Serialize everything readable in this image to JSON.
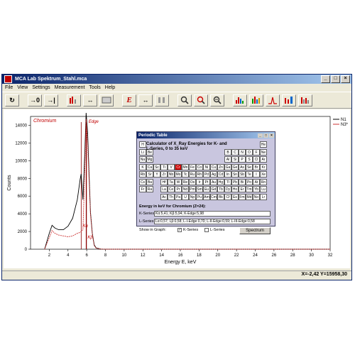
{
  "window": {
    "title": "MCA Lab    Spektrum_Stahl.mca",
    "min": "_",
    "max": "□",
    "close": "×"
  },
  "menu": [
    "File",
    "View",
    "Settings",
    "Measurement",
    "Tools",
    "Help"
  ],
  "toolbar": {
    "reset": "↻",
    "zero": "→0",
    "stop": "→|",
    "energy": "E"
  },
  "chart_data": {
    "type": "line",
    "series": [
      {
        "name": "N1",
        "color": "#000000",
        "x": [
          1.5,
          2.0,
          2.3,
          2.6,
          3.0,
          3.5,
          4.0,
          4.5,
          5.0,
          5.3,
          5.41,
          5.6,
          5.8,
          5.94,
          6.1,
          6.4,
          6.6,
          6.8,
          7.0,
          7.5,
          8.0,
          9.0,
          12,
          16,
          20,
          26,
          32
        ],
        "y": [
          0,
          1800,
          2700,
          2400,
          2200,
          2200,
          2600,
          3500,
          5600,
          7900,
          8500,
          5600,
          11000,
          15400,
          13200,
          4200,
          1800,
          500,
          150,
          20,
          0,
          0,
          0,
          0,
          0,
          0,
          0
        ]
      },
      {
        "name": "N3*",
        "color": "#cc3333",
        "x": [
          1.5,
          2.0,
          2.3,
          2.6,
          3.0,
          3.5,
          4.0,
          4.5,
          5.0,
          5.3,
          5.41,
          5.6,
          5.8,
          5.94,
          6.1,
          6.4,
          6.6,
          6.8,
          7.0,
          7.5,
          8.0,
          9.0,
          12,
          16,
          20,
          26,
          32
        ],
        "y": [
          0,
          1300,
          2100,
          1800,
          1600,
          1500,
          1400,
          1500,
          1800,
          1900,
          2000,
          2200,
          9000,
          14700,
          12000,
          4000,
          1700,
          400,
          120,
          20,
          0,
          0,
          0,
          0,
          0,
          0,
          0
        ]
      }
    ],
    "xlim": [
      0,
      32
    ],
    "ylim": [
      0,
      15000
    ],
    "xticks": [
      2,
      4,
      6,
      8,
      10,
      12,
      14,
      16,
      18,
      20,
      22,
      24,
      26,
      28,
      30,
      32
    ],
    "yticks": [
      0,
      2000,
      4000,
      6000,
      8000,
      10000,
      12000,
      14000
    ],
    "xlabel": "Energy E, keV",
    "ylabel": "Counts",
    "annotation": "Chromium",
    "markers": [
      {
        "x": 5.41,
        "label": "Kα"
      },
      {
        "x": 5.94,
        "label": "Kβ"
      },
      {
        "x": 5.98,
        "label": "Edge"
      }
    ],
    "legend_position": "top-right"
  },
  "status": "X=-2,42 Y=15958,30",
  "periodic_table": {
    "title": "Periodic Table",
    "calculator_text": "Calculator of X_Ray Energies for K- and L-Series, 0 to 35 keV",
    "selected": "Cr",
    "row1": [
      "H",
      "He"
    ],
    "row2": [
      "Li",
      "Be",
      "B",
      "C",
      "N",
      "O",
      "F",
      "Ne"
    ],
    "row3": [
      "Na",
      "Mg",
      "Al",
      "Si",
      "P",
      "S",
      "Cl",
      "Ar"
    ],
    "row4": [
      "K",
      "Ca",
      "Sc",
      "Ti",
      "V",
      "Cr",
      "Mn",
      "Fe",
      "Co",
      "Ni",
      "Cu",
      "Zn",
      "Ga",
      "Ge",
      "As",
      "Se",
      "Br",
      "Kr"
    ],
    "row5": [
      "Rb",
      "Sr",
      "Y",
      "Zr",
      "Nb",
      "Mo",
      "Tc",
      "Ru",
      "Rh",
      "Pd",
      "Ag",
      "Cd",
      "In",
      "Sn",
      "Sb",
      "Te",
      "I",
      "Xe"
    ],
    "row6": [
      "Cs",
      "Ba",
      "",
      "Hf",
      "Ta",
      "W",
      "Re",
      "Os",
      "Ir",
      "Pt",
      "Au",
      "Hg",
      "Tl",
      "Pb",
      "Bi",
      "Po",
      "At",
      "Rn"
    ],
    "row7": [
      "Fr",
      "Ra"
    ],
    "lanth": [
      "La",
      "Ce",
      "Pr",
      "Nd",
      "Pm",
      "Sm",
      "Eu",
      "Gd",
      "Tb",
      "Dy",
      "Ho",
      "Er",
      "Tm",
      "Yb",
      "Lu"
    ],
    "actin": [
      "Ac",
      "Th",
      "Pa",
      "U",
      "Np",
      "Pu",
      "Am",
      "Cm",
      "Bk",
      "Cf",
      "Es",
      "Fm",
      "Md",
      "No",
      "Lr"
    ],
    "energy_heading": "Energy in keV for Chromium (Z=24):",
    "k_label": "K-Series",
    "k_value": "Kα:5,41; Kβ:5,94; K-Edge:5,98",
    "l_label": "L-Series",
    "l_value": "Lα:0,57; Lβ:0,58; L-I-Edge:0,70; L-II-Edge:0,59; L-III-Edge:0,58",
    "show_label": "Show in Graph:",
    "k_check": "K-Series",
    "l_check": "L-Series",
    "spectrum_button": "Spectrum"
  }
}
